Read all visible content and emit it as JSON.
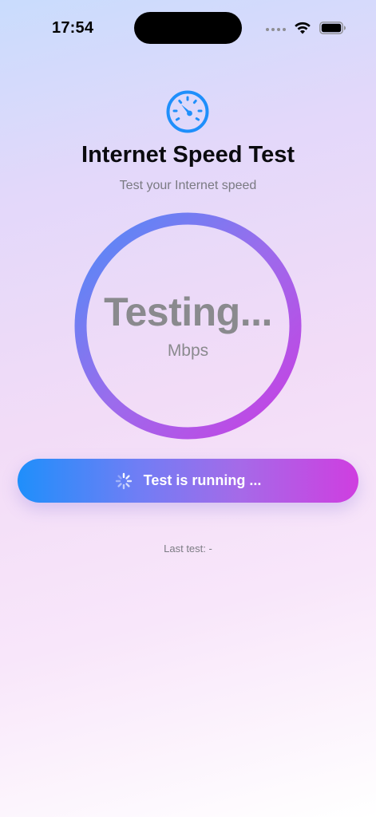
{
  "status_bar": {
    "time": "17:54",
    "icons": [
      "cellular-dots-icon",
      "wifi-icon",
      "battery-icon"
    ]
  },
  "header": {
    "icon": "speedometer-icon",
    "title": "Internet Speed Test",
    "subtitle": "Test your Internet speed"
  },
  "gauge": {
    "value_text": "Testing...",
    "unit": "Mbps"
  },
  "action_button": {
    "icon": "spinner-icon",
    "label": "Test is running ..."
  },
  "footer": {
    "last_test": "Last test: -"
  },
  "colors": {
    "accent_blue": "#1f8ffb",
    "accent_magenta": "#cf3ee0",
    "text_secondary": "#8a8a8e"
  }
}
